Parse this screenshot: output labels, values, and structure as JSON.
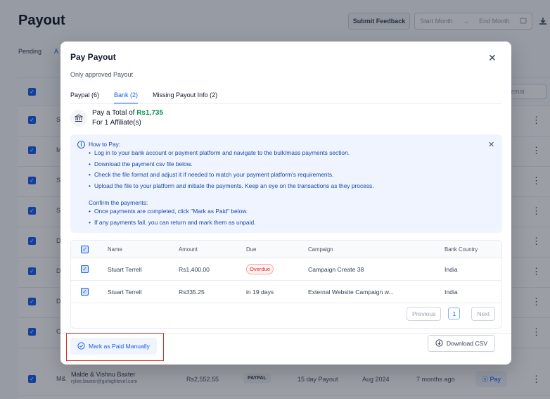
{
  "background": {
    "page_title": "Payout",
    "submit_feedback": "Submit Feedback",
    "start_month": "Start Month",
    "arrow": "→",
    "end_month": "End Month",
    "tabs": [
      "Pending",
      "A"
    ],
    "search_placeholder": "emai",
    "row_initials": [
      "S",
      "M",
      "S",
      "S",
      "D",
      "D",
      "D",
      "C",
      "M&"
    ],
    "last_row": {
      "name": "Malde & Vishnu Baxter",
      "email": "rylee.baxter@gohighlevel.com",
      "amount": "Rs2,552.55",
      "method": "PAYPAL",
      "campaign": "15 day Payout",
      "period": "Aug 2024",
      "time": "7 months ago",
      "pay": "Pay"
    }
  },
  "modal": {
    "title": "Pay Payout",
    "subtitle": "Only approved Payout",
    "tabs": [
      {
        "label": "Paypal (6)",
        "active": false
      },
      {
        "label": "Bank (2)",
        "active": true
      },
      {
        "label": "Missing Payout Info (2)",
        "active": false
      }
    ],
    "total": {
      "prefix": "Pay a Total of ",
      "amount": "Rs1,735",
      "affiliates": "For 1 Affiliate(s)"
    },
    "info": {
      "title": "How to Pay:",
      "steps": [
        "Log in to your bank account or payment platform and navigate to the bulk/mass payments section.",
        "Download the payment csv file below.",
        "Check the file format and adjust it if needed to match your payment platform's requirements.",
        "Upload the file to your platform and initiate the payments. Keep an eye on the transactions as they process."
      ],
      "confirm_title": "Confirm the payments:",
      "confirm_steps": [
        "Once payments are completed, click \"Mark as Paid\" below.",
        "If any payments fail, you can return and mark them as unpaid."
      ]
    },
    "table": {
      "headers": {
        "name": "Name",
        "amount": "Amount",
        "due": "Due",
        "campaign": "Campaign",
        "country": "Bank Country"
      },
      "rows": [
        {
          "name": "Stuart Terrell",
          "amount": "Rs1,400.00",
          "due": "Overdue",
          "campaign": "Campaign Create 38",
          "country": "India"
        },
        {
          "name": "Stuart Terrell",
          "amount": "Rs335.25",
          "due": "in 19 days",
          "campaign": "External Website Campaign w...",
          "country": "India"
        }
      ],
      "pagination": {
        "previous": "Previous",
        "page": "1",
        "next": "Next"
      }
    },
    "mark_paid_label": "Mark as Paid Manually",
    "download_csv_label": "Download CSV"
  }
}
